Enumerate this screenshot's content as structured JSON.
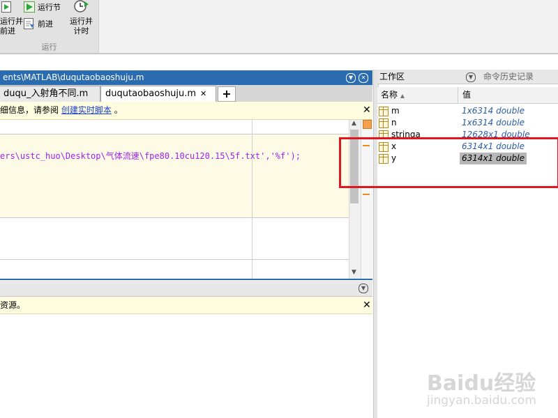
{
  "ribbon": {
    "btn_run_advance": "运行并\n前进",
    "btn_run_section": "运行节",
    "btn_advance": "前进",
    "btn_run_time": "运行并\n计时",
    "group_label": "运行"
  },
  "editor": {
    "title": "ents\\MATLAB\\duqutaobaoshuju.m",
    "tabs": [
      {
        "label": "duqu_入射角不同.m",
        "active": false
      },
      {
        "label": "duqutaobaoshuju.m",
        "active": true
      }
    ],
    "add_tab": "+",
    "info_text": "细信息，请参阅",
    "info_link": "创建实时脚本",
    "info_end": "。",
    "code_path": "ers\\ustc_huo\\Desktop\\气体流速\\fpe80.10cu120.15\\5f.txt'",
    "code_tail": ",'%f');"
  },
  "command_window": {
    "info_text": "资源。"
  },
  "workspace": {
    "title": "工作区",
    "history_tab": "命令历史记录",
    "col_name": "名称",
    "col_sort": "▲",
    "col_value": "值",
    "variables": [
      {
        "name": "m",
        "value": "1x6314 double",
        "selected": false
      },
      {
        "name": "n",
        "value": "1x6314 double",
        "selected": false
      },
      {
        "name": "stringa",
        "value": "12628x1 double",
        "selected": false
      },
      {
        "name": "x",
        "value": "6314x1 double",
        "selected": false
      },
      {
        "name": "y",
        "value": "6314x1 double",
        "selected": true
      }
    ]
  },
  "watermark": {
    "logo": "Baidu经验",
    "url": "jingyan.baidu.com"
  },
  "colors": {
    "accent_blue": "#2b6cb0",
    "info_bg": "#fffde0",
    "highlight_red": "#e0171f",
    "var_value_blue": "#2a5da8"
  }
}
